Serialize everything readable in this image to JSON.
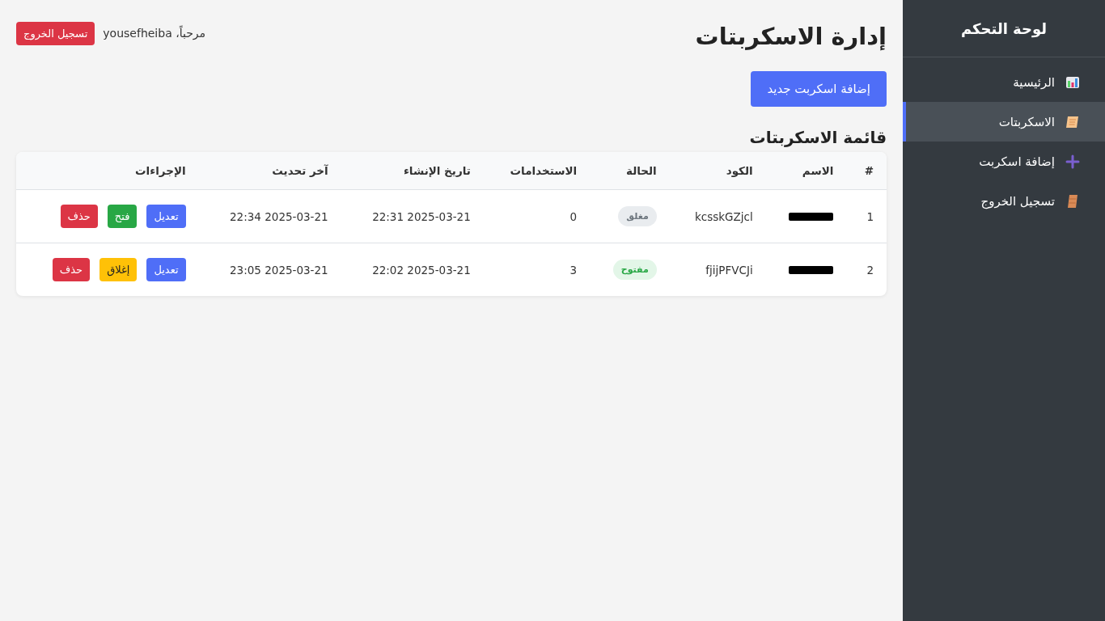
{
  "sidebar": {
    "title": "لوحة التحكم",
    "items": [
      {
        "label": "الرئيسية",
        "selected": false
      },
      {
        "label": "الاسكربتات",
        "selected": true
      },
      {
        "label": "إضافة اسكربت",
        "selected": false
      },
      {
        "label": "تسجيل الخروج",
        "selected": false
      }
    ]
  },
  "header": {
    "title": "إدارة الاسكربتات",
    "greeting": "مرحباً، yousefheiba",
    "logout_button": "تسجيل الخروج"
  },
  "add_button": "إضافة اسكربت جديد",
  "list_title": "قائمة الاسكربتات",
  "table": {
    "columns": [
      "#",
      "الاسم",
      "الكود",
      "الحالة",
      "الاستخدامات",
      "تاريخ الإنشاء",
      "آخر تحديث",
      "الإجراءات"
    ],
    "rows": [
      {
        "index": "1",
        "name_redacted": true,
        "code": "kcsskGZjcl",
        "open": false,
        "status_label": "مغلق",
        "uses": "0",
        "created": "2025-03-21 22:31",
        "updated": "2025-03-21 22:34",
        "actions": [
          "تعديل",
          "فتح",
          "حذف"
        ]
      },
      {
        "index": "2",
        "name_redacted": true,
        "code": "fjijPFVCJi",
        "open": true,
        "status_label": "مفتوح",
        "uses": "3",
        "created": "2025-03-21 22:02",
        "updated": "2025-03-21 23:05",
        "actions": [
          "تعديل",
          "إغلاق",
          "حذف"
        ]
      }
    ]
  }
}
